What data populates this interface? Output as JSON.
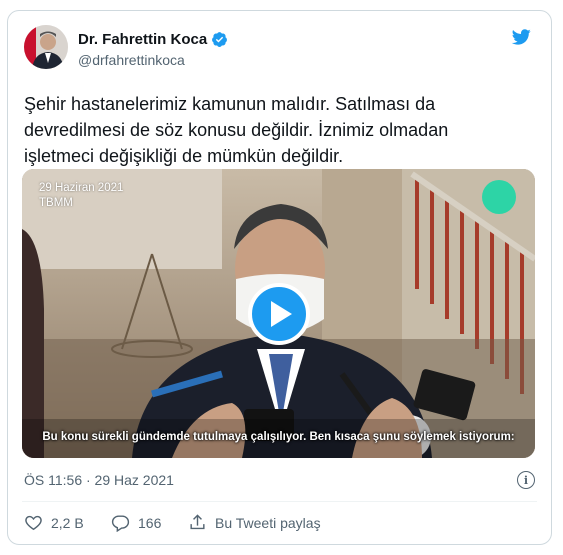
{
  "author": {
    "name": "Dr. Fahrettin Koca",
    "handle": "@drfahrettinkoca",
    "verified": true
  },
  "tweet": {
    "text": "Şehir hastanelerimiz kamunun malıdır. Satılması da\ndevredilmesi de söz konusu değildir. İznimiz olmadan\nişletmeci değişikliği de mümkün değildir.",
    "timestamp": "ÖS 11:56 · 29 Haz 2021"
  },
  "video": {
    "date_overlay": "29 Haziran 2021",
    "location_overlay": "TBMM",
    "subtitle": "Bu konu sürekli gündemde tutulmaya çalışılıyor. Ben kısaca şunu söylemek istiyorum:"
  },
  "actions": {
    "likes": "2,2 B",
    "replies": "166",
    "share_label": "Bu Tweeti paylaş"
  },
  "colors": {
    "accent": "#1d9bf0",
    "text": "#0f1419",
    "muted": "#536471",
    "border": "#cfd9de"
  }
}
